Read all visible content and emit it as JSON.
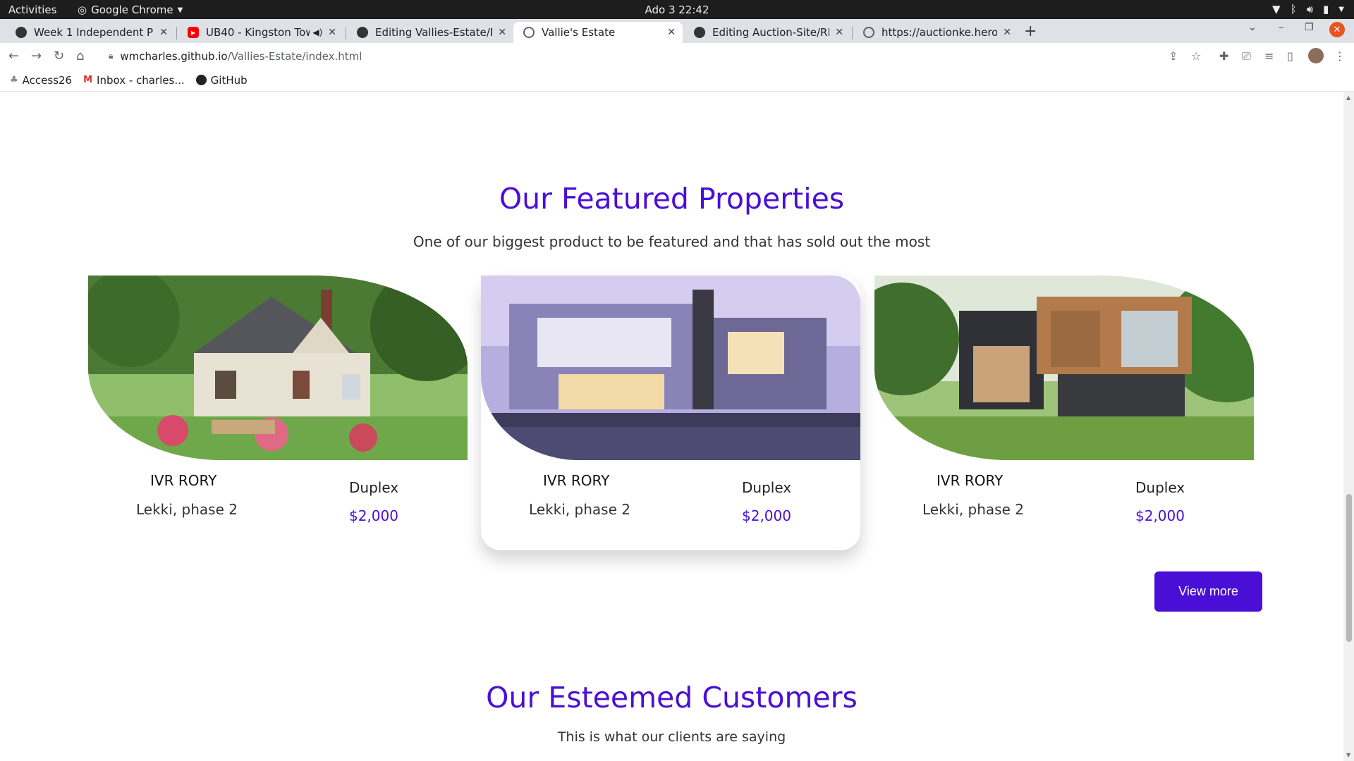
{
  "os_bar": {
    "activities": "Activities",
    "app_name": "Google Chrome",
    "clock": "Ado 3  22:42"
  },
  "tabs": [
    {
      "title": "Week 1 Independent Proj",
      "icon": "github-icon"
    },
    {
      "title": "UB40 - Kingston Town",
      "icon": "youtube-icon"
    },
    {
      "title": "Editing Vallies-Estate/RE",
      "icon": "github-icon"
    },
    {
      "title": "Vallie's Estate",
      "icon": "globe-icon"
    },
    {
      "title": "Editing Auction-Site/REA",
      "icon": "github-icon"
    },
    {
      "title": "https://auctionke.heroku",
      "icon": "globe-icon"
    }
  ],
  "address": {
    "host": "wmcharles.github.io",
    "path": "/Vallies-Estate/index.html"
  },
  "bookmarks": [
    {
      "label": "Access26",
      "icon": "leaf-icon"
    },
    {
      "label": "Inbox - charles...",
      "icon": "gmail-icon"
    },
    {
      "label": "GitHub",
      "icon": "github-icon"
    }
  ],
  "featured": {
    "title": "Our Featured Properties",
    "subtitle": "One of our biggest product to be featured and that has sold out the most",
    "cards": [
      {
        "name": "IVR RORY",
        "type": "Duplex",
        "location": "Lekki, phase 2",
        "price": "$2,000"
      },
      {
        "name": "IVR RORY",
        "type": "Duplex",
        "location": "Lekki, phase 2",
        "price": "$2,000"
      },
      {
        "name": "IVR RORY",
        "type": "Duplex",
        "location": "Lekki, phase 2",
        "price": "$2,000"
      }
    ],
    "view_more": "View more"
  },
  "customers": {
    "title": "Our Esteemed Customers",
    "subtitle": "This is what our clients are saying"
  },
  "colors": {
    "accent": "#4a0fd6"
  }
}
